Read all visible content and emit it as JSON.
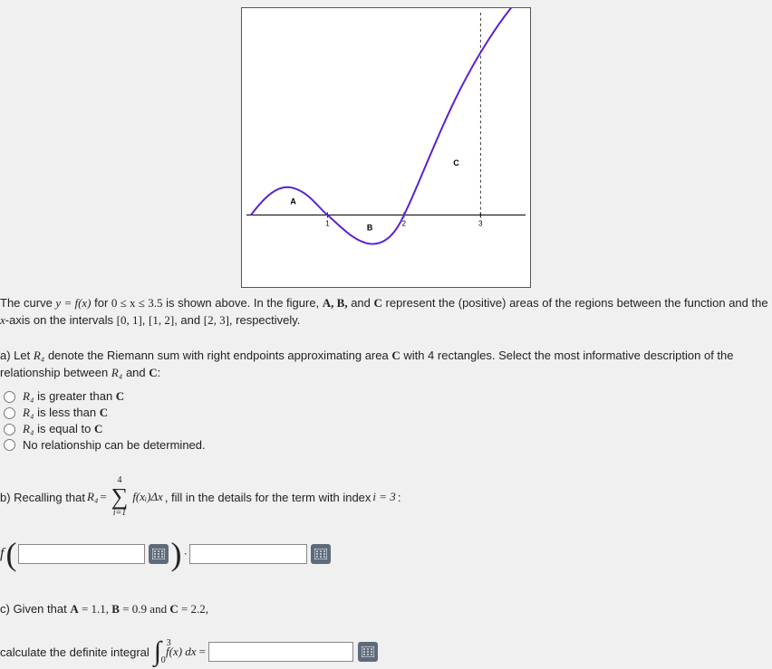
{
  "intro": {
    "p1_a": "The curve ",
    "curve_eq": "y = f(x)",
    "p1_b": " for ",
    "domain": "0 ≤ x ≤ 3.5",
    "p1_c": " is shown above. In the figure, ",
    "ABC": "A, B,",
    "and": " and ",
    "C": "C",
    "p1_d": " represent the (positive) areas of the regions between the function and the ",
    "xaxis": "x",
    "p1_e": "-axis on the intervals ",
    "int1": "[0, 1]",
    "comma1": ", ",
    "int2": "[1, 2]",
    "comma2": ", and ",
    "int3": "[2, 3]",
    "p1_f": ", respectively."
  },
  "partA": {
    "q_a": "a) Let ",
    "R4": "R₄",
    "q_b": " denote the Riemann sum with right endpoints approximating area ",
    "C": "C",
    "q_c": " with 4 rectangles. Select the most informative description of the relationship between ",
    "R4b": "R₄",
    "q_d": " and ",
    "Cb": "C",
    "q_e": ":",
    "opt1_a": "R₄",
    "opt1_b": " is greater than ",
    "opt1_c": "C",
    "opt2_a": "R₄",
    "opt2_b": " is less than ",
    "opt2_c": "C",
    "opt3_a": "R₄",
    "opt3_b": " is equal to ",
    "opt3_c": "C",
    "opt4": "No relationship can be determined."
  },
  "partB": {
    "q_a": "b) Recalling that ",
    "R4": "R₄",
    "eq": " = ",
    "sum_top": "4",
    "sum_sigma": "∑",
    "sum_bot": "i=1",
    "summand": "f(xᵢ)Δx",
    "q_b": ", fill in the details for the term with index ",
    "idx": "i = 3",
    "q_c": ":",
    "f_label": "f",
    "dot": " · "
  },
  "partC": {
    "q_a": "c) Given that ",
    "A": "A",
    "Aval": " = 1.1, ",
    "B": "B",
    "Bval": " = 0.9 and ",
    "C": "C",
    "Cval": " = 2.2,",
    "q_b": "calculate the definite integral ",
    "int_upper": "3",
    "int_lower": "0",
    "integrand": " f(x) dx",
    "eq": " = "
  },
  "graph": {
    "labels": {
      "A": "A",
      "B": "B",
      "C": "C",
      "t1": "1",
      "t2": "2",
      "t3": "3"
    }
  },
  "chart_data": {
    "type": "line",
    "xrange": [
      0,
      3.5
    ],
    "yrange": [
      -2.5,
      10
    ],
    "xaxis_y": 0,
    "curve_description": "Quartic-like curve: starts at origin, rises to local max ≈1.3 near x=0.55, crosses x-axis at x=1, dips to local min ≈-1.3 near x=1.55, crosses x-axis at x=2, then rises steeply through (3, ~6) continuing up past x=3.5.",
    "signed_areas": {
      "A": 1.1,
      "B": -0.9,
      "C": 2.2
    },
    "x_ticks": [
      1,
      2,
      3
    ],
    "region_labels": [
      {
        "text": "A",
        "x": 0.55,
        "y": 0.7
      },
      {
        "text": "B",
        "x": 1.55,
        "y": -0.5
      },
      {
        "text": "C",
        "x": 2.7,
        "y": 2.5
      }
    ],
    "dashed_line": {
      "x": 3,
      "from_y": 0,
      "to_y": 10
    }
  }
}
